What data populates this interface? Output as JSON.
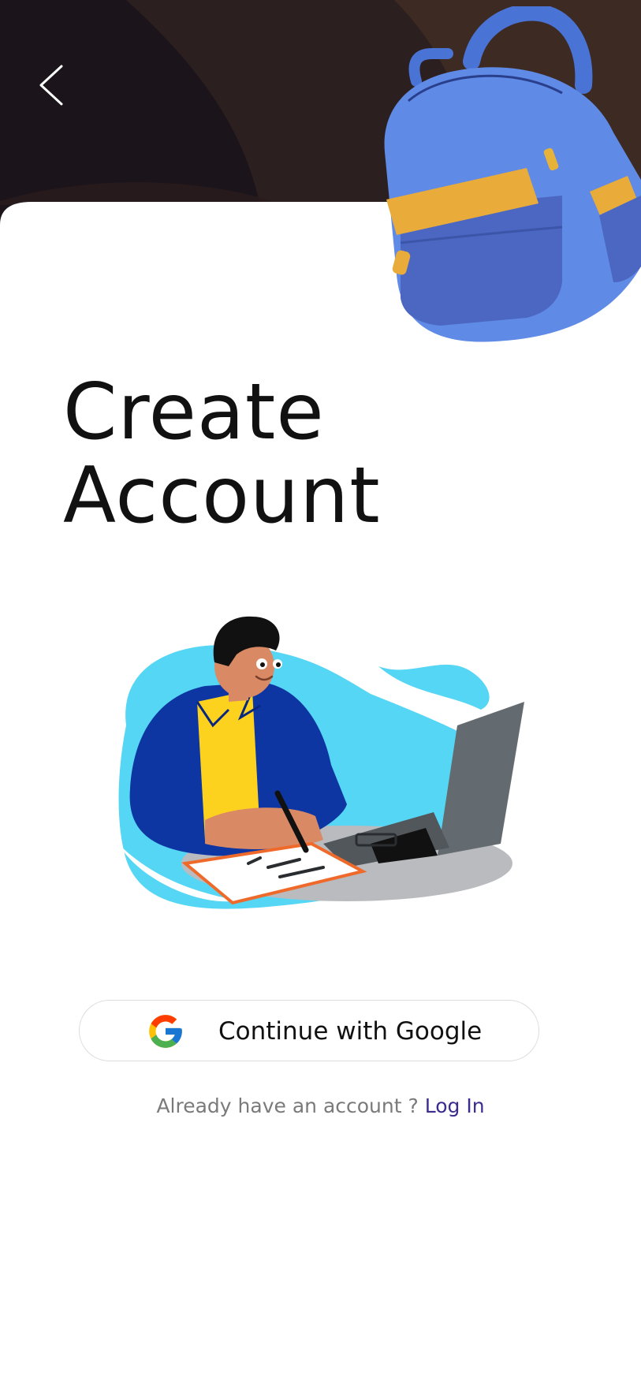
{
  "header": {
    "back_icon": "chevron-left-icon",
    "illustration": "backpack-illustration",
    "colors": {
      "dark": "#1b151b",
      "brown": "#3d2a22"
    }
  },
  "title": {
    "line1": "Create",
    "line2": "Account"
  },
  "illustration": {
    "name": "person-writing-at-laptop",
    "colors": {
      "blob": "#55d6f4",
      "jacket": "#0e36a3",
      "shirt": "#fdd21f"
    }
  },
  "google_button": {
    "label": "Continue with Google",
    "icon": "google-icon"
  },
  "login": {
    "prompt": "Already have an account ?",
    "link": "Log In",
    "link_color": "#3a2d8f"
  }
}
